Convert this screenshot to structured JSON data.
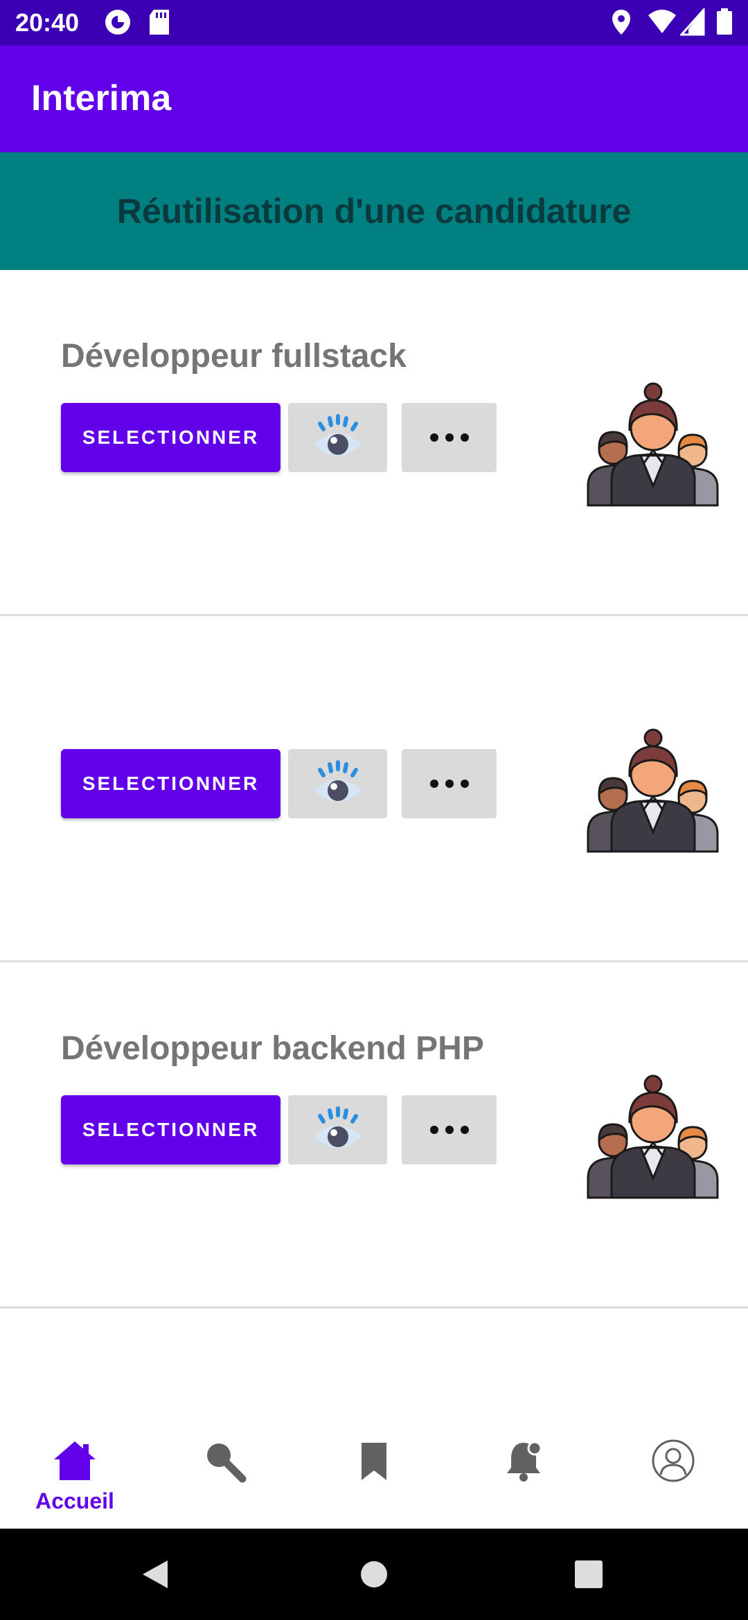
{
  "status_bar": {
    "time": "20:40",
    "icons": [
      "app-c-icon",
      "sd-card-icon",
      "location-icon",
      "wifi-icon",
      "signal-icon",
      "battery-icon"
    ]
  },
  "app_bar": {
    "title": "Interima"
  },
  "banner": {
    "title": "Réutilisation d'une candidature"
  },
  "cards": [
    {
      "title": "Développeur fullstack",
      "select_label": "SELECTIONNER",
      "icons": [
        "eye-icon",
        "more-dots-icon",
        "team-illustration-icon"
      ]
    },
    {
      "title": "",
      "select_label": "SELECTIONNER",
      "icons": [
        "eye-icon",
        "more-dots-icon",
        "team-illustration-icon"
      ]
    },
    {
      "title": "Développeur backend PHP",
      "select_label": "SELECTIONNER",
      "icons": [
        "eye-icon",
        "more-dots-icon",
        "team-illustration-icon"
      ]
    }
  ],
  "bottom_nav": {
    "items": [
      {
        "label": "Accueil",
        "icon": "home-icon",
        "active": true
      },
      {
        "label": "",
        "icon": "search-icon",
        "active": false
      },
      {
        "label": "",
        "icon": "bookmark-icon",
        "active": false
      },
      {
        "label": "",
        "icon": "notification-bell-icon",
        "active": false
      },
      {
        "label": "",
        "icon": "profile-icon",
        "active": false
      }
    ]
  },
  "colors": {
    "primary": "#6200ea",
    "status_bar": "#3c00b4",
    "banner": "#008080",
    "banner_text": "#0b3a3e",
    "card_title": "#757575",
    "secondary_button": "#dadada",
    "inactive_icon": "#616161"
  }
}
